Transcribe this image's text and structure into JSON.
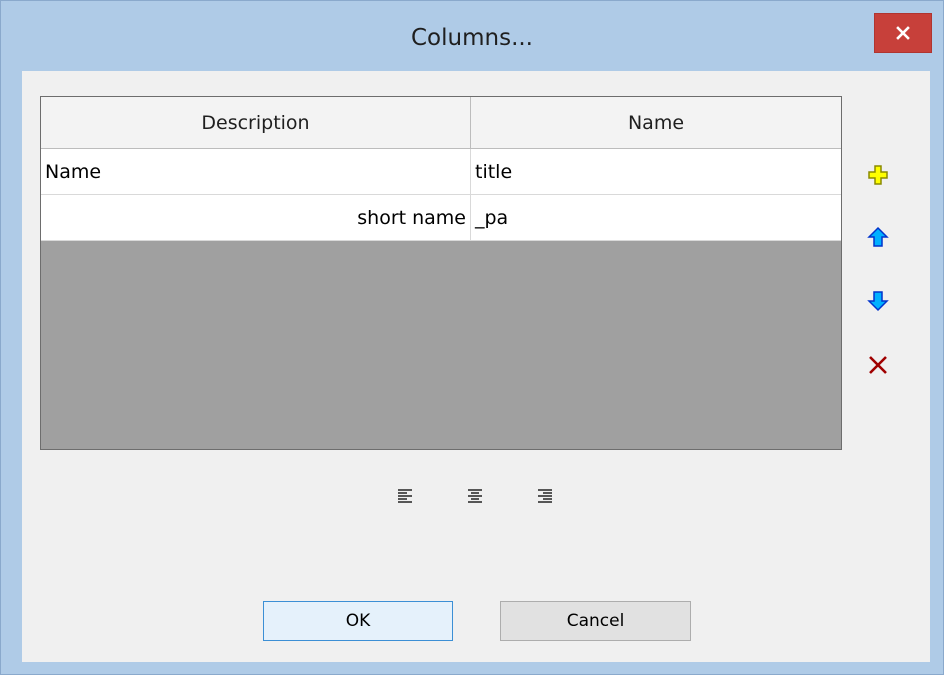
{
  "window": {
    "title": "Columns...",
    "close_icon": "close-icon"
  },
  "grid": {
    "columns": [
      "Description",
      "Name"
    ],
    "rows": [
      {
        "description": "Name",
        "name": "title",
        "description_align": "left"
      },
      {
        "description": "short name",
        "name": "_pa",
        "description_align": "right"
      }
    ]
  },
  "side_tools": [
    {
      "icon": "add-icon",
      "color": "#ffff00"
    },
    {
      "icon": "move-up-icon",
      "color": "#00b0ff"
    },
    {
      "icon": "move-down-icon",
      "color": "#00b0ff"
    },
    {
      "icon": "delete-icon",
      "color": "#a00000"
    }
  ],
  "align_tools": [
    "align-left-icon",
    "align-center-icon",
    "align-right-icon"
  ],
  "buttons": {
    "ok_label": "OK",
    "cancel_label": "Cancel"
  }
}
